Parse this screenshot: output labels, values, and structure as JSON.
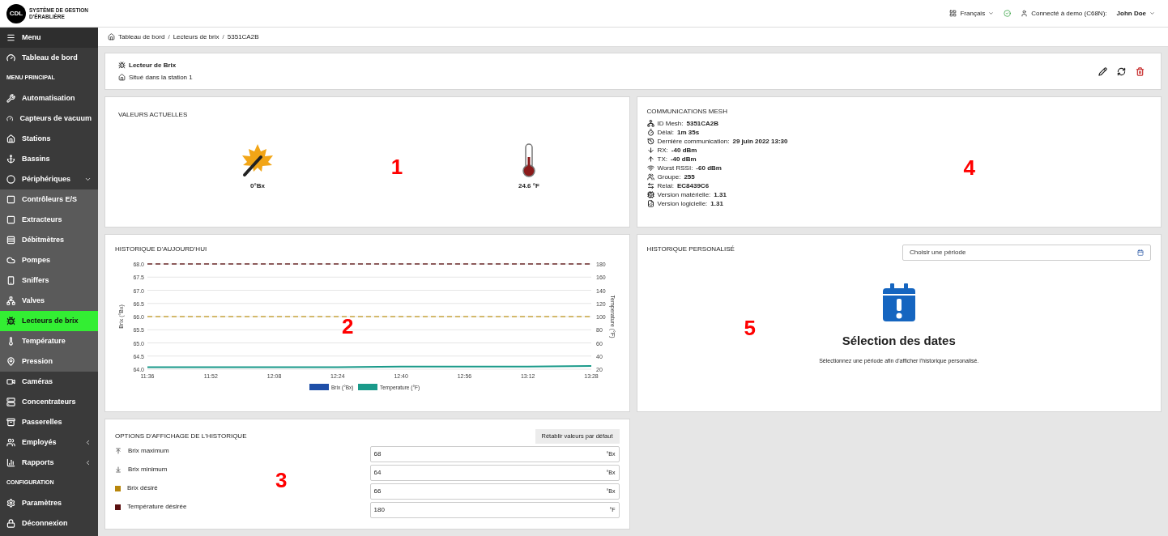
{
  "header": {
    "logo_badge": "CDL",
    "logo_text": "SYSTÈME DE GESTION D'ÉRABLIÈRE",
    "language": "Français",
    "connection": "Connecté à demo (C68N):",
    "user": "John Doe"
  },
  "sidebar": {
    "items": [
      {
        "kind": "menu",
        "label": "Menu",
        "selected": false
      },
      {
        "kind": "item",
        "label": "Tableau de bord",
        "selected": false
      },
      {
        "kind": "section",
        "label": "MENU PRINCIPAL"
      },
      {
        "kind": "item",
        "label": "Automatisation",
        "selected": false
      },
      {
        "kind": "item",
        "label": "Capteurs de vacuum",
        "selected": false
      },
      {
        "kind": "item",
        "label": "Stations",
        "selected": false
      },
      {
        "kind": "item",
        "label": "Bassins",
        "selected": false
      },
      {
        "kind": "item",
        "label": "Périphériques",
        "selected": false,
        "expanded": true,
        "children": [
          {
            "label": "Contrôleurs E/S",
            "selected": false
          },
          {
            "label": "Extracteurs",
            "selected": false
          },
          {
            "label": "Débitmètres",
            "selected": false
          },
          {
            "label": "Pompes",
            "selected": false
          },
          {
            "label": "Sniffers",
            "selected": false
          },
          {
            "label": "Valves",
            "selected": false
          },
          {
            "label": "Lecteurs de brix",
            "selected": true
          },
          {
            "label": "Température",
            "selected": false
          },
          {
            "label": "Pression",
            "selected": false
          }
        ]
      },
      {
        "kind": "item",
        "label": "Caméras",
        "selected": false
      },
      {
        "kind": "item",
        "label": "Concentrateurs",
        "selected": false
      },
      {
        "kind": "item",
        "label": "Passerelles",
        "selected": false
      },
      {
        "kind": "item",
        "label": "Employés",
        "selected": false,
        "expanded": false
      },
      {
        "kind": "item",
        "label": "Rapports",
        "selected": false,
        "expanded": false
      },
      {
        "kind": "section",
        "label": "CONFIGURATION"
      },
      {
        "kind": "item",
        "label": "Paramètres",
        "selected": false
      },
      {
        "kind": "item",
        "label": "Déconnexion",
        "selected": false
      }
    ]
  },
  "breadcrumb": {
    "separator": "/",
    "items": [
      "Tableau de bord",
      "Lecteurs de brix",
      "5351CA2B"
    ]
  },
  "device": {
    "title": "Lecteur de Brix",
    "location": "Situé dans la station 1"
  },
  "current_values": {
    "title": "VALEURS ACTUELLES",
    "callout": "1",
    "readings": [
      {
        "value": "0°Bx"
      },
      {
        "value": "24.6 °F"
      }
    ]
  },
  "mesh": {
    "title": "COMMUNICATIONS MESH",
    "callout": "4",
    "rows": [
      {
        "label": "ID Mesh:",
        "value": "5351CA2B"
      },
      {
        "label": "Délai:",
        "value": "1m 35s"
      },
      {
        "label": "Dernière communication:",
        "value": "29 juin 2022 13:30"
      },
      {
        "label": "RX:",
        "value": "-40 dBm"
      },
      {
        "label": "TX:",
        "value": "-40 dBm"
      },
      {
        "label": "Worst RSSI:",
        "value": "-60 dBm"
      },
      {
        "label": "Groupe:",
        "value": "255"
      },
      {
        "label": "Relai:",
        "value": "EC8439C6"
      },
      {
        "label": "Version matérielle:",
        "value": "1.31"
      },
      {
        "label": "Version logicielle:",
        "value": "1.31"
      }
    ]
  },
  "history_today": {
    "title": "HISTORIQUE D'AUJOURD'HUI",
    "callout": "2",
    "chart_data": {
      "type": "line",
      "ylabel": "Brix (°Bx)",
      "y2label": "Temperature (°F)",
      "categories": [
        "11:36",
        "11:52",
        "12:08",
        "12:24",
        "12:40",
        "12:56",
        "13:12",
        "13:28"
      ],
      "ylim": [
        64,
        68
      ],
      "yticks": [
        {
          "value": 64,
          "label": "64.0"
        },
        {
          "value": 64.5,
          "label": "64.5"
        },
        {
          "value": 65,
          "label": "65.0"
        },
        {
          "value": 65.5,
          "label": "65.5"
        },
        {
          "value": 66,
          "label": "66.0"
        },
        {
          "value": 66.5,
          "label": "66.5"
        },
        {
          "value": 67,
          "label": "67.0"
        },
        {
          "value": 67.5,
          "label": "67.5"
        },
        {
          "value": 68,
          "label": "68.0"
        }
      ],
      "y2lim": [
        20,
        180
      ],
      "y2ticks": [
        20,
        40,
        60,
        80,
        100,
        120,
        140,
        160,
        180
      ],
      "series": [
        {
          "name": "Brix (°Bx)",
          "color": "#1f4fa8",
          "values": [
            null,
            null,
            null,
            null,
            null,
            null,
            null,
            null
          ]
        },
        {
          "name": "Temperature (°F)",
          "color": "#1a9a8a",
          "axis": "y2",
          "values": [
            23,
            23,
            23,
            23,
            24,
            24,
            24,
            25
          ]
        },
        {
          "color": "#6b2a2a",
          "line_style": "dashed",
          "values": [
            68,
            68,
            68,
            68,
            68,
            68,
            68,
            68
          ]
        },
        {
          "color": "#c9a640",
          "line_style": "dashed",
          "values": [
            66,
            66,
            66,
            66,
            66,
            66,
            66,
            66
          ]
        }
      ],
      "grid": true
    }
  },
  "custom_history": {
    "title": "HISTORIQUE PERSONALISÉ",
    "callout": "5",
    "period_placeholder": "Choisir une période",
    "empty_title": "Sélection des dates",
    "empty_text": "Sélectionnez une période afin d'afficher l'historique personalisé."
  },
  "display_options": {
    "title": "OPTIONS D'AFFICHAGE DE L'HISTORIQUE",
    "callout": "3",
    "reset_button": "Rétablir valeurs par défaut",
    "fields": [
      {
        "kind": "max",
        "label": "Brix maximum",
        "value": "68",
        "unit": "°Bx"
      },
      {
        "kind": "min",
        "label": "Brix minimum",
        "value": "64",
        "unit": "°Bx"
      },
      {
        "kind": "swatch",
        "label": "Brix désiré",
        "value": "66",
        "unit": "°Bx",
        "color": "#b8860b"
      },
      {
        "kind": "swatch",
        "label": "Température désirée",
        "value": "180",
        "unit": "°F",
        "color": "#5a0f0f"
      }
    ]
  }
}
